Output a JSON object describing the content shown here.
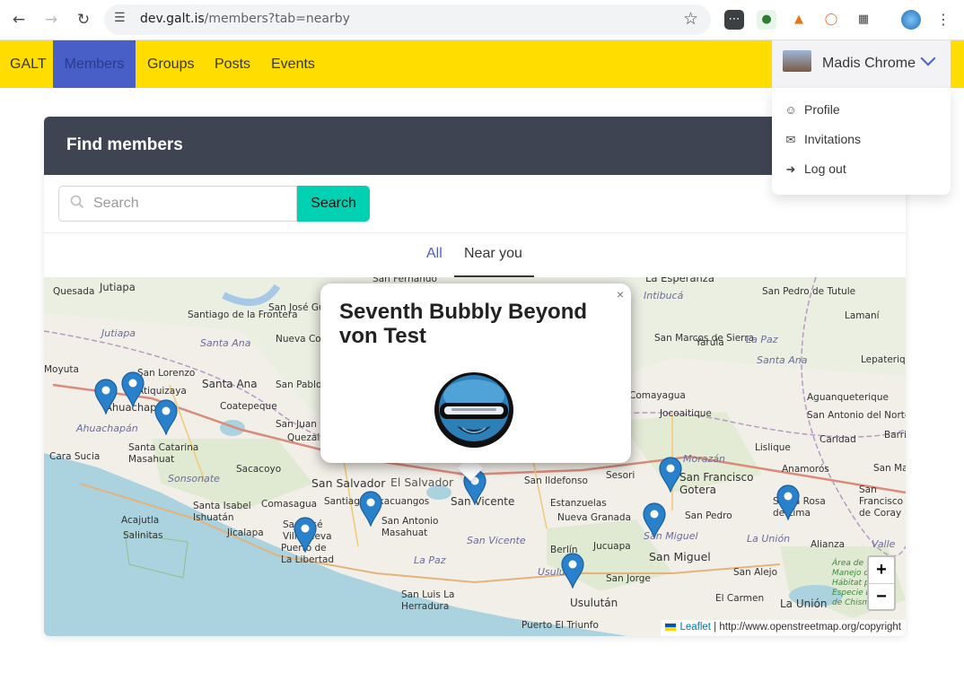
{
  "browser": {
    "url_host": "dev.galt.is",
    "url_path": "/members?tab=nearby"
  },
  "nav": {
    "brand": "GALT",
    "items": [
      {
        "label": "Members"
      },
      {
        "label": "Groups"
      },
      {
        "label": "Posts"
      },
      {
        "label": "Events"
      }
    ],
    "user_name": "Madis Chrome",
    "dropdown": [
      {
        "label": "Profile",
        "icon": "user-icon"
      },
      {
        "label": "Invitations",
        "icon": "inbox-icon"
      },
      {
        "label": "Log out",
        "icon": "logout-icon"
      }
    ]
  },
  "card": {
    "title": "Find members",
    "search_placeholder": "Search",
    "search_button": "Search",
    "tabs": [
      {
        "label": "All"
      },
      {
        "label": "Near you"
      }
    ]
  },
  "map": {
    "popup_title": "Seventh Bubbly Beyond von Test",
    "popup_close": "×",
    "zoom_in": "+",
    "zoom_out": "−",
    "attribution_link": "Leaflet",
    "attribution_text": " | http://www.openstreetmap.org/copyright",
    "places": [
      "Quesada",
      "Jutiapa",
      "San Fernando",
      "La Esperanza",
      "San Pedro de Tutule",
      "Intibucá",
      "Santiago de la Frontera",
      "San José Guachipilín",
      "Jutiapa",
      "Santa Ana",
      "Nueva Concepción",
      "San Marcos de Sierra",
      "Yarula",
      "La Paz",
      "Lamaní",
      "Moyuta",
      "San Lorenzo",
      "Atiquizaya",
      "Ahuachapán",
      "Santa Ana",
      "San Pablo Tacachico",
      "Santa Ana",
      "Comayagua",
      "Aguanqueterique",
      "Coatepeque",
      "San Juan Opico",
      "Quezaltepeque",
      "Jocoaitique",
      "San Antonio del Norte",
      "Caridad",
      "Ahuachapán",
      "Santa Catarina Masahuat",
      "Lislique",
      "Cara Sucia",
      "Sonsonate",
      "Sacacoyo",
      "San Salvador",
      "El Salvador",
      "Sesori",
      "Morazán",
      "San Francisco Gotera",
      "Anamorós",
      "San Ildefonso",
      "Santa Isabel Ishuatán",
      "Comasagua",
      "Santiago Texacuangos",
      "San Vicente",
      "Estanzuelas",
      "Nueva Granada",
      "San Pedro",
      "San Miguel",
      "Santa Rosa de Lima",
      "La Unión",
      "Acajutla",
      "San José Villanueva",
      "San Antonio Masahuat",
      "Salinitas",
      "Jicalapa",
      "Puerto de La Libertad",
      "San Vicente",
      "Berlín",
      "Jucuapa",
      "Usulután",
      "San Jorge",
      "San Miguel",
      "San Alejo",
      "Alianza",
      "La Paz",
      "Usulután",
      "San Luis La Herradura",
      "El Carmen",
      "La Unión",
      "Puerto El Triunfo",
      "Lepaterique",
      "Barrio",
      "San Marcos",
      "San Francisco de Coray",
      "Valle",
      "Área de Manejo de Hábitat por Especie Bahía de Chismuyo"
    ]
  }
}
